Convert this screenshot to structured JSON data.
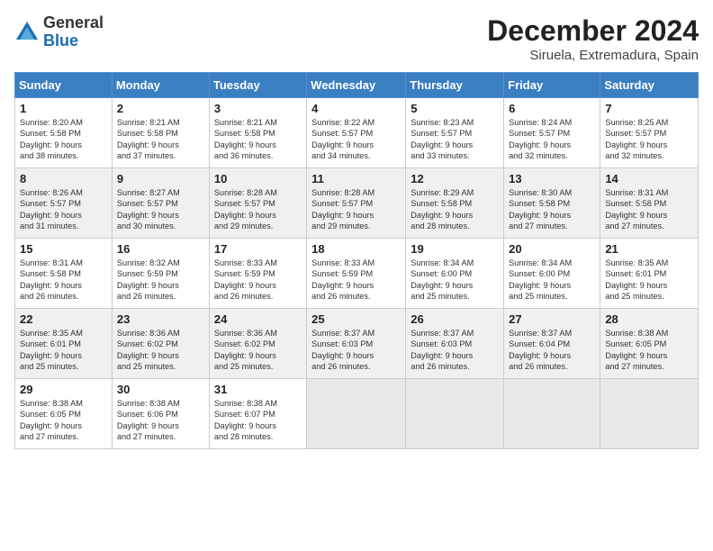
{
  "logo": {
    "general": "General",
    "blue": "Blue"
  },
  "title": "December 2024",
  "subtitle": "Siruela, Extremadura, Spain",
  "days_of_week": [
    "Sunday",
    "Monday",
    "Tuesday",
    "Wednesday",
    "Thursday",
    "Friday",
    "Saturday"
  ],
  "weeks": [
    [
      {
        "day": "1",
        "info": "Sunrise: 8:20 AM\nSunset: 5:58 PM\nDaylight: 9 hours\nand 38 minutes."
      },
      {
        "day": "2",
        "info": "Sunrise: 8:21 AM\nSunset: 5:58 PM\nDaylight: 9 hours\nand 37 minutes."
      },
      {
        "day": "3",
        "info": "Sunrise: 8:21 AM\nSunset: 5:58 PM\nDaylight: 9 hours\nand 36 minutes."
      },
      {
        "day": "4",
        "info": "Sunrise: 8:22 AM\nSunset: 5:57 PM\nDaylight: 9 hours\nand 34 minutes."
      },
      {
        "day": "5",
        "info": "Sunrise: 8:23 AM\nSunset: 5:57 PM\nDaylight: 9 hours\nand 33 minutes."
      },
      {
        "day": "6",
        "info": "Sunrise: 8:24 AM\nSunset: 5:57 PM\nDaylight: 9 hours\nand 32 minutes."
      },
      {
        "day": "7",
        "info": "Sunrise: 8:25 AM\nSunset: 5:57 PM\nDaylight: 9 hours\nand 32 minutes."
      }
    ],
    [
      {
        "day": "8",
        "info": "Sunrise: 8:26 AM\nSunset: 5:57 PM\nDaylight: 9 hours\nand 31 minutes."
      },
      {
        "day": "9",
        "info": "Sunrise: 8:27 AM\nSunset: 5:57 PM\nDaylight: 9 hours\nand 30 minutes."
      },
      {
        "day": "10",
        "info": "Sunrise: 8:28 AM\nSunset: 5:57 PM\nDaylight: 9 hours\nand 29 minutes."
      },
      {
        "day": "11",
        "info": "Sunrise: 8:28 AM\nSunset: 5:57 PM\nDaylight: 9 hours\nand 29 minutes."
      },
      {
        "day": "12",
        "info": "Sunrise: 8:29 AM\nSunset: 5:58 PM\nDaylight: 9 hours\nand 28 minutes."
      },
      {
        "day": "13",
        "info": "Sunrise: 8:30 AM\nSunset: 5:58 PM\nDaylight: 9 hours\nand 27 minutes."
      },
      {
        "day": "14",
        "info": "Sunrise: 8:31 AM\nSunset: 5:58 PM\nDaylight: 9 hours\nand 27 minutes."
      }
    ],
    [
      {
        "day": "15",
        "info": "Sunrise: 8:31 AM\nSunset: 5:58 PM\nDaylight: 9 hours\nand 26 minutes."
      },
      {
        "day": "16",
        "info": "Sunrise: 8:32 AM\nSunset: 5:59 PM\nDaylight: 9 hours\nand 26 minutes."
      },
      {
        "day": "17",
        "info": "Sunrise: 8:33 AM\nSunset: 5:59 PM\nDaylight: 9 hours\nand 26 minutes."
      },
      {
        "day": "18",
        "info": "Sunrise: 8:33 AM\nSunset: 5:59 PM\nDaylight: 9 hours\nand 26 minutes."
      },
      {
        "day": "19",
        "info": "Sunrise: 8:34 AM\nSunset: 6:00 PM\nDaylight: 9 hours\nand 25 minutes."
      },
      {
        "day": "20",
        "info": "Sunrise: 8:34 AM\nSunset: 6:00 PM\nDaylight: 9 hours\nand 25 minutes."
      },
      {
        "day": "21",
        "info": "Sunrise: 8:35 AM\nSunset: 6:01 PM\nDaylight: 9 hours\nand 25 minutes."
      }
    ],
    [
      {
        "day": "22",
        "info": "Sunrise: 8:35 AM\nSunset: 6:01 PM\nDaylight: 9 hours\nand 25 minutes."
      },
      {
        "day": "23",
        "info": "Sunrise: 8:36 AM\nSunset: 6:02 PM\nDaylight: 9 hours\nand 25 minutes."
      },
      {
        "day": "24",
        "info": "Sunrise: 8:36 AM\nSunset: 6:02 PM\nDaylight: 9 hours\nand 25 minutes."
      },
      {
        "day": "25",
        "info": "Sunrise: 8:37 AM\nSunset: 6:03 PM\nDaylight: 9 hours\nand 26 minutes."
      },
      {
        "day": "26",
        "info": "Sunrise: 8:37 AM\nSunset: 6:03 PM\nDaylight: 9 hours\nand 26 minutes."
      },
      {
        "day": "27",
        "info": "Sunrise: 8:37 AM\nSunset: 6:04 PM\nDaylight: 9 hours\nand 26 minutes."
      },
      {
        "day": "28",
        "info": "Sunrise: 8:38 AM\nSunset: 6:05 PM\nDaylight: 9 hours\nand 27 minutes."
      }
    ],
    [
      {
        "day": "29",
        "info": "Sunrise: 8:38 AM\nSunset: 6:05 PM\nDaylight: 9 hours\nand 27 minutes."
      },
      {
        "day": "30",
        "info": "Sunrise: 8:38 AM\nSunset: 6:06 PM\nDaylight: 9 hours\nand 27 minutes."
      },
      {
        "day": "31",
        "info": "Sunrise: 8:38 AM\nSunset: 6:07 PM\nDaylight: 9 hours\nand 28 minutes."
      },
      {
        "day": "",
        "info": ""
      },
      {
        "day": "",
        "info": ""
      },
      {
        "day": "",
        "info": ""
      },
      {
        "day": "",
        "info": ""
      }
    ]
  ]
}
